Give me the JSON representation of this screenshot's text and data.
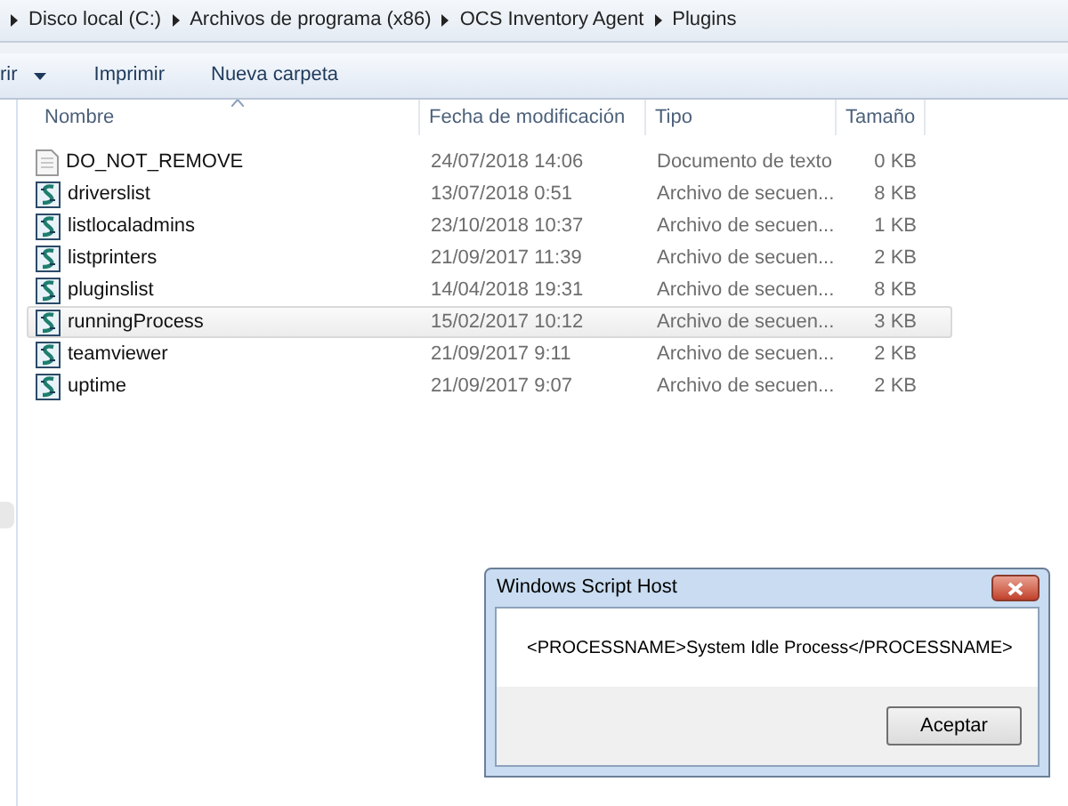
{
  "breadcrumb": [
    "Disco local (C:)",
    "Archivos de programa (x86)",
    "OCS Inventory Agent",
    "Plugins"
  ],
  "toolbar": [
    {
      "label": "rir",
      "has_menu": true
    },
    {
      "label": "Imprimir",
      "has_menu": false
    },
    {
      "label": "Nueva carpeta",
      "has_menu": false
    }
  ],
  "columns": [
    "Nombre",
    "Fecha de modificación",
    "Tipo",
    "Tamaño"
  ],
  "files": [
    {
      "kind": "text",
      "name": "DO_NOT_REMOVE",
      "date": "24/07/2018 14:06",
      "type": "Documento de texto",
      "size": "0 KB",
      "hovered": false
    },
    {
      "kind": "script",
      "name": "driverslist",
      "date": "13/07/2018 0:51",
      "type": "Archivo de secuen...",
      "size": "8 KB",
      "hovered": false
    },
    {
      "kind": "script",
      "name": "listlocaladmins",
      "date": "23/10/2018 10:37",
      "type": "Archivo de secuen...",
      "size": "1 KB",
      "hovered": false
    },
    {
      "kind": "script",
      "name": "listprinters",
      "date": "21/09/2017 11:39",
      "type": "Archivo de secuen...",
      "size": "2 KB",
      "hovered": false
    },
    {
      "kind": "script",
      "name": "pluginslist",
      "date": "14/04/2018 19:31",
      "type": "Archivo de secuen...",
      "size": "8 KB",
      "hovered": false
    },
    {
      "kind": "script",
      "name": "runningProcess",
      "date": "15/02/2017 10:12",
      "type": "Archivo de secuen...",
      "size": "3 KB",
      "hovered": true
    },
    {
      "kind": "script",
      "name": "teamviewer",
      "date": "21/09/2017 9:11",
      "type": "Archivo de secuen...",
      "size": "2 KB",
      "hovered": false
    },
    {
      "kind": "script",
      "name": "uptime",
      "date": "21/09/2017 9:07",
      "type": "Archivo de secuen...",
      "size": "2 KB",
      "hovered": false
    }
  ],
  "dialog": {
    "title": "Windows Script Host",
    "message": "<PROCESSNAME>System Idle Process</PROCESSNAME>",
    "button": "Aceptar"
  }
}
